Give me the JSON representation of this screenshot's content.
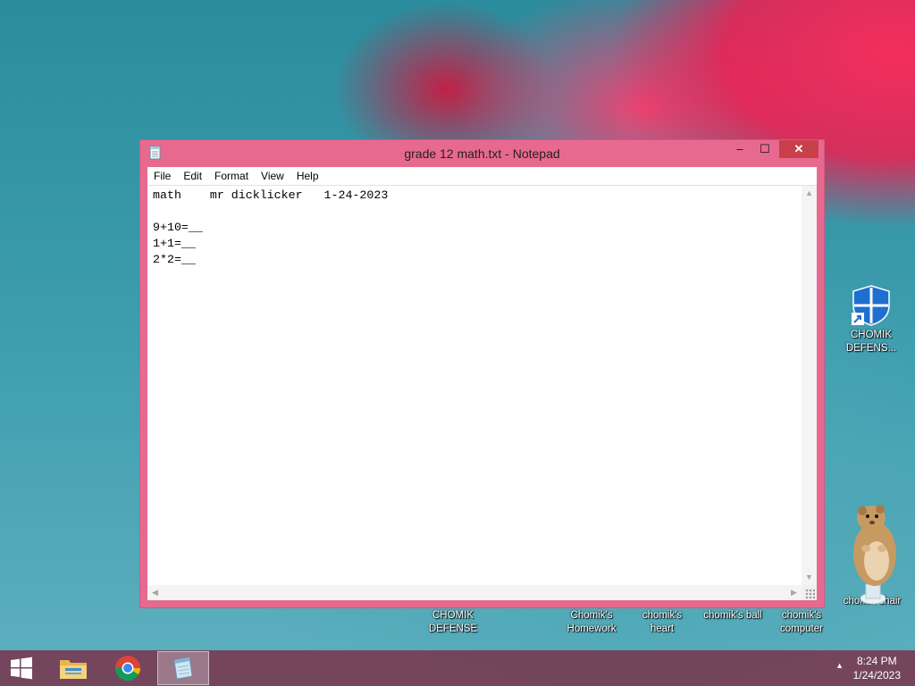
{
  "window": {
    "title": "grade 12 math.txt - Notepad",
    "min_glyph": "‒",
    "max_glyph": "☐",
    "close_glyph": "✕"
  },
  "menu": [
    "File",
    "Edit",
    "Format",
    "View",
    "Help"
  ],
  "document": {
    "lines": [
      "math    mr dicklicker   1-24-2023",
      "",
      "9+10=__",
      "1+1=__",
      "2*2=__"
    ]
  },
  "desktop_icons": [
    {
      "name": "desktop-icon-chomik-defensé-shortcut",
      "label": "CHOMIK DEFENS..."
    },
    {
      "name": "desktop-icon-chomik-defense",
      "label": "CHOMIK DEFENSE"
    },
    {
      "name": "desktop-icon-chomiks-homework",
      "label": "Chomik's Homework"
    },
    {
      "name": "desktop-icon-chomiks-heart",
      "label": "chomik's heart"
    },
    {
      "name": "desktop-icon-chomiks-ball",
      "label": "chomik's ball"
    },
    {
      "name": "desktop-icon-chomiks-computer",
      "label": "chomik's computer"
    },
    {
      "name": "desktop-icon-chomik-chair",
      "label": "chomik chair"
    }
  ],
  "taskbar": {
    "tray_arrow": "▲",
    "time": "8:24 PM",
    "date": "1/24/2023"
  },
  "colors": {
    "window_frame": "#e8698f",
    "close_button": "#c7404a",
    "taskbar": "#783750"
  }
}
